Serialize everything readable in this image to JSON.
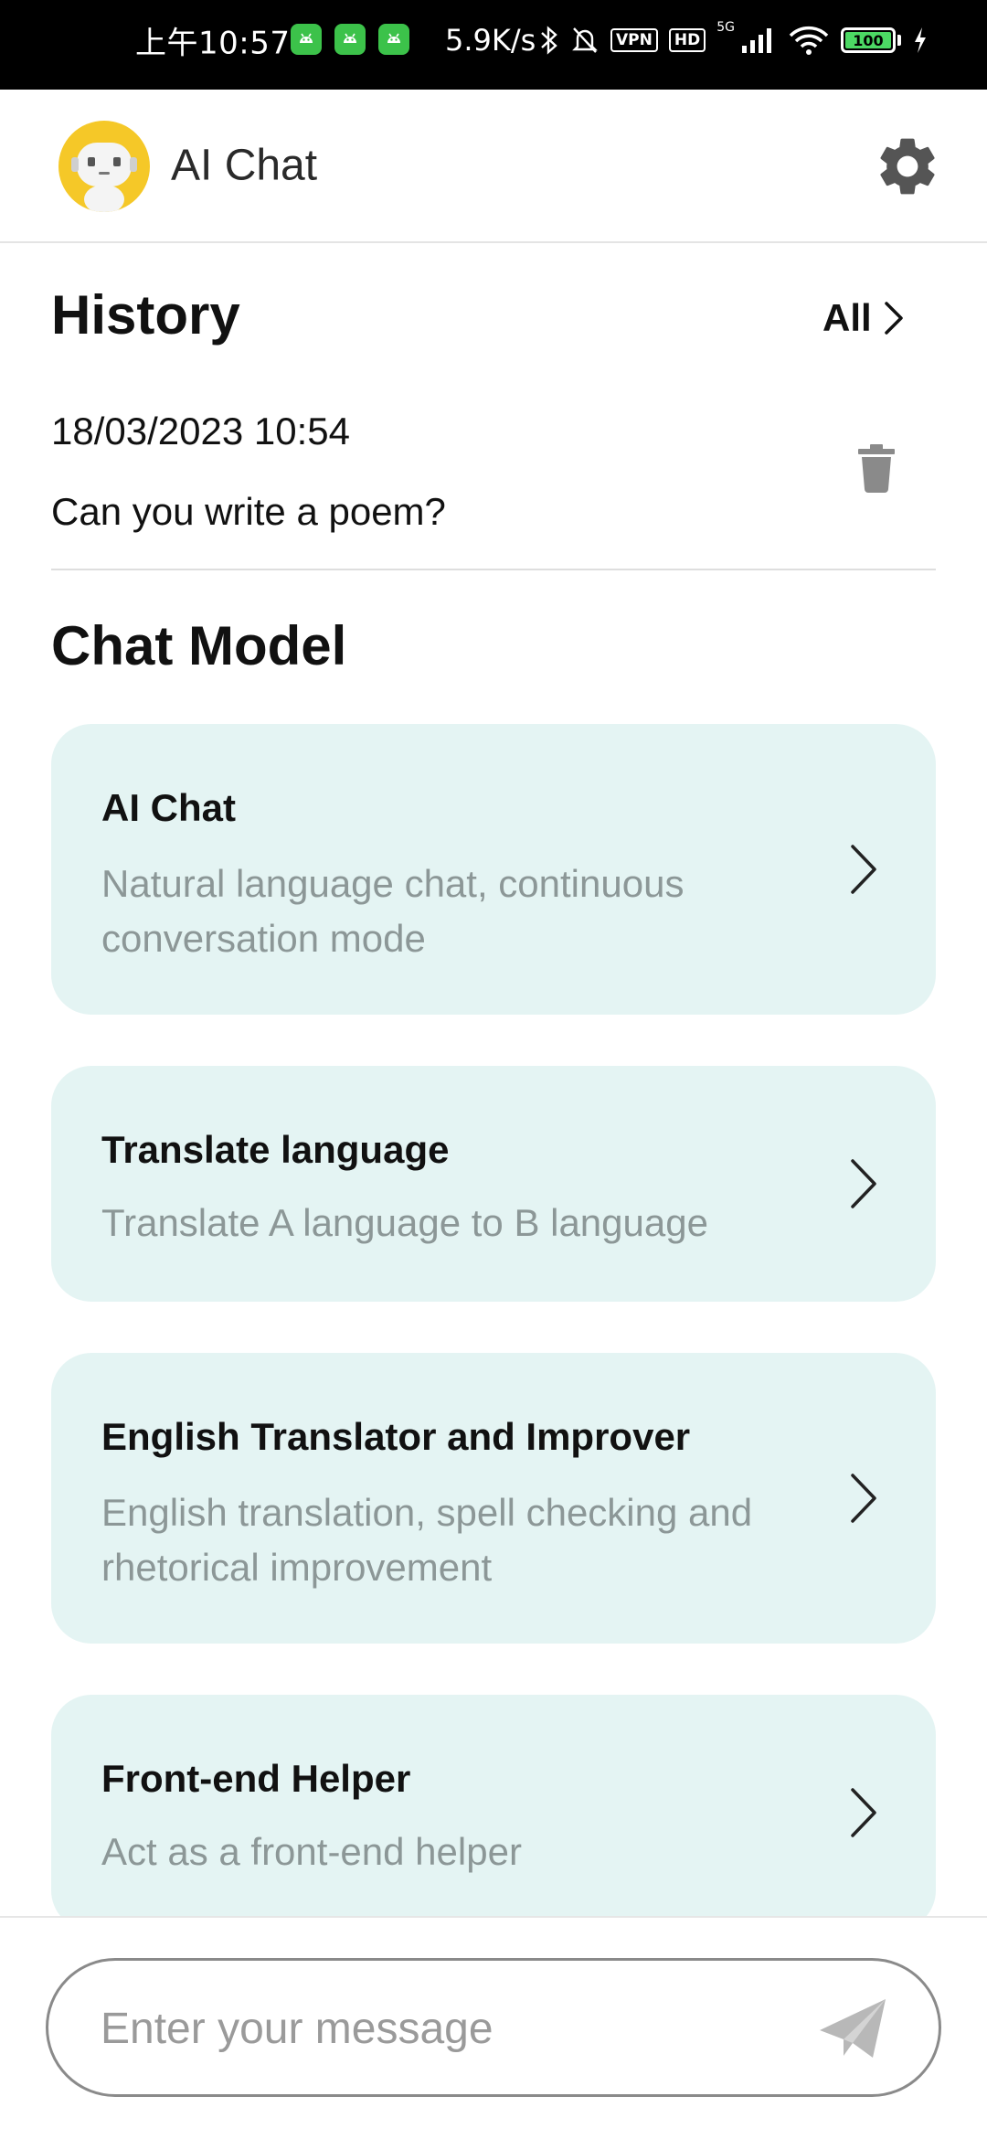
{
  "status_bar": {
    "time": "上午10:57",
    "net_speed": "5.9K/s",
    "vpn_label": "VPN",
    "hd_label": "HD",
    "network_label": "5G",
    "battery": "100",
    "app_icons": [
      "android-icon",
      "android-icon",
      "android-icon"
    ]
  },
  "header": {
    "title": "AI Chat",
    "avatar_icon": "robot-avatar-icon",
    "settings_icon": "gear-icon"
  },
  "history": {
    "title": "History",
    "all_label": "All",
    "items": [
      {
        "date": "18/03/2023 10:54",
        "text": "Can you write a poem?"
      }
    ]
  },
  "chat_model": {
    "title": "Chat Model",
    "cards": [
      {
        "title": "AI Chat",
        "desc": "Natural language chat, continuous conversation mode"
      },
      {
        "title": "Translate language",
        "desc": "Translate A language to B language"
      },
      {
        "title": "English Translator and Improver",
        "desc": "English translation, spell checking and rhetorical improvement"
      },
      {
        "title": "Front-end Helper",
        "desc": "Act as a front-end helper"
      }
    ]
  },
  "composer": {
    "placeholder": "Enter your message",
    "send_icon": "send-icon"
  },
  "colors": {
    "card_background": "#e4f4f3",
    "avatar_background": "#f5c828",
    "battery_fill": "#4cd964"
  }
}
